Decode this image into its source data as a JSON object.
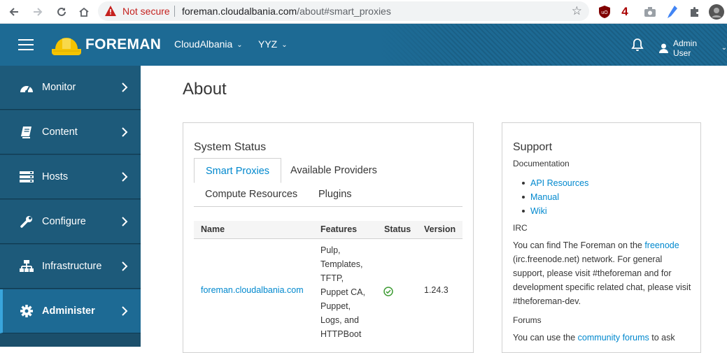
{
  "browser": {
    "not_secure_label": "Not secure",
    "url_host": "foreman.cloudalbania.com",
    "url_path": "/about#smart_proxies",
    "ext_badge_count": "4"
  },
  "header": {
    "brand": "FOREMAN",
    "organization": "CloudAlbania",
    "location": "YYZ",
    "user": "Admin User",
    "bg_color": "#1d6a94"
  },
  "sidebar": {
    "items": [
      {
        "label": "Monitor",
        "icon": "dashboard-icon"
      },
      {
        "label": "Content",
        "icon": "book-icon"
      },
      {
        "label": "Hosts",
        "icon": "server-icon"
      },
      {
        "label": "Configure",
        "icon": "wrench-icon"
      },
      {
        "label": "Infrastructure",
        "icon": "sitemap-icon"
      },
      {
        "label": "Administer",
        "icon": "cog-icon",
        "active": true
      }
    ]
  },
  "main": {
    "title": "About",
    "system_status": {
      "heading": "System Status",
      "tabs": [
        "Smart Proxies",
        "Available Providers",
        "Compute Resources",
        "Plugins"
      ],
      "active_tab": "Smart Proxies",
      "table": {
        "columns": [
          "Name",
          "Features",
          "Status",
          "Version"
        ],
        "rows": [
          {
            "name": "foreman.cloudalbania.com",
            "features_lines": [
              "Pulp,",
              "Templates,",
              "TFTP,",
              "Puppet CA,",
              "Puppet,",
              "Logs, and",
              "HTTPBoot"
            ],
            "status": "ok",
            "version": "1.24.3"
          }
        ]
      }
    },
    "support": {
      "heading": "Support",
      "documentation_label": "Documentation",
      "links": [
        "API Resources",
        "Manual",
        "Wiki"
      ],
      "irc_label": "IRC",
      "irc_text_1": "You can find The Foreman on the ",
      "irc_link": "freenode",
      "irc_text_2": " (irc.freenode.net) network. For general support, please visit #theforeman and for development specific related chat, please visit #theforeman-dev.",
      "forums_label": "Forums",
      "forums_text_1": "You can use the ",
      "forums_link": "community forums",
      "forums_text_2": " to ask"
    }
  },
  "colors": {
    "link": "#0088ce",
    "sidebar": "#1d5a7a",
    "sidebar_active": "#1d6a94",
    "status_ok": "#3f9c35"
  }
}
